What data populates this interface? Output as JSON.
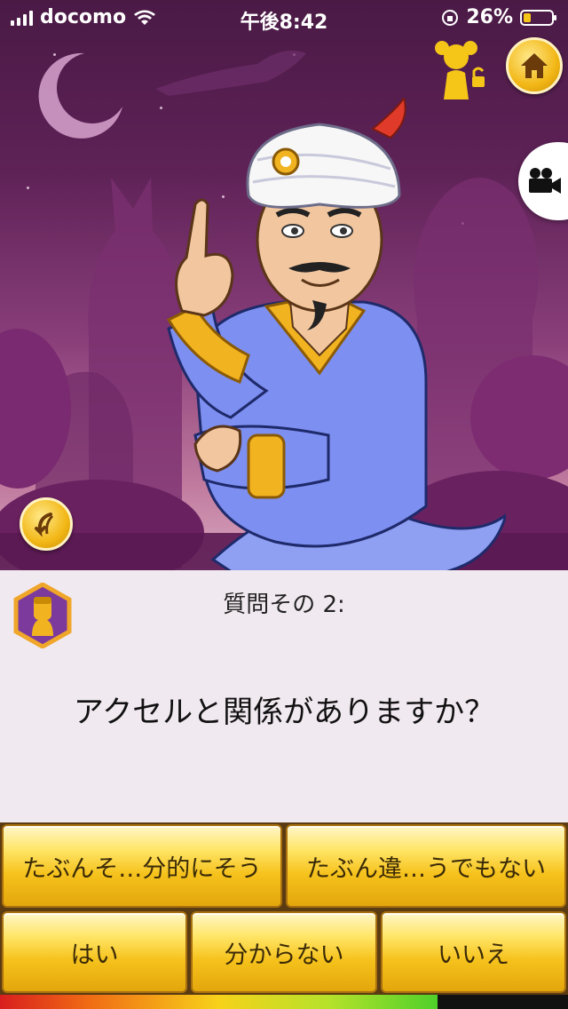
{
  "status_bar": {
    "carrier": "docomo",
    "time": "午後8:42",
    "battery_percent": "26%",
    "battery_level": 0.26
  },
  "top_buttons": {
    "kid_lock_icon": "child-lock-icon",
    "home_icon": "home-icon",
    "video_icon": "video-camera-icon"
  },
  "question": {
    "number_label": "質問その 2:",
    "text": "アクセルと関係がありますか？"
  },
  "answers": {
    "probably_yes": "たぶんそ…分的にそう",
    "probably_no": "たぶん違…うでもない",
    "yes": "はい",
    "dont_know": "分からない",
    "no": "いいえ"
  },
  "progress": {
    "fraction": 0.77
  },
  "colors": {
    "accent_gold": "#f6c21c",
    "panel_bg": "#f1e9f0",
    "scene_purple": "#5e2257"
  }
}
